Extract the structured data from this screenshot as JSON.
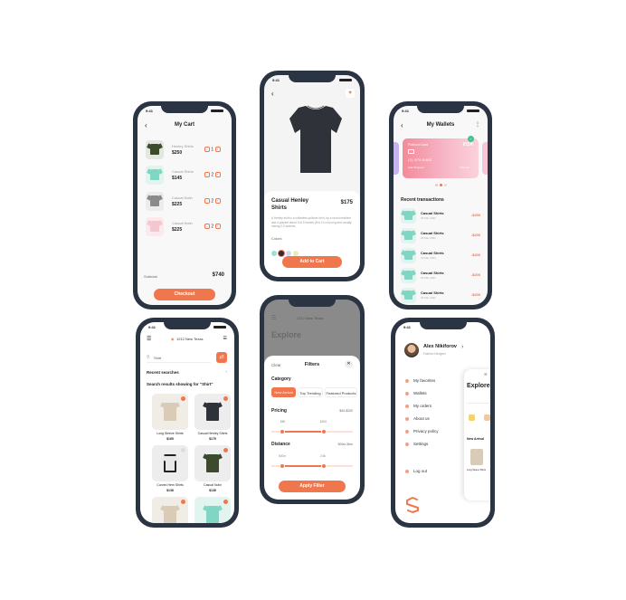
{
  "cart": {
    "time": "9:41",
    "title": "My Cart",
    "items": [
      {
        "name": "Henley Shirts",
        "price": "$250",
        "qty": "1",
        "color": "#3c4a2e"
      },
      {
        "name": "Casual Shirts",
        "price": "$145",
        "qty": "2",
        "color": "#7fd6c2"
      },
      {
        "name": "Casual Nolin",
        "price": "$225",
        "qty": "2",
        "color": "#8a8a8a"
      },
      {
        "name": "Casual Nolin",
        "price": "$225",
        "qty": "2",
        "color": "#f4c7d0"
      }
    ],
    "subtotal_label": "Subtotal",
    "subtotal_value": "$740",
    "checkout": "Checkout"
  },
  "product": {
    "time": "9:41",
    "name_line1": "Casual Henley",
    "name_line2": "Shirts",
    "price": "$175",
    "description": "A Henley shirt is a collarless pullover shirt, by a round neckline and a placket about 3 to 5 inches (8 to 13 cm) long and usually having 2-5 buttons.",
    "colors_label": "Colors",
    "colors": [
      "#9be0d0",
      "#2b2b3a",
      "#cfd8f0",
      "#f3e6b8"
    ],
    "add_to_cart": "Add to Cart"
  },
  "wallet": {
    "time": "9:41",
    "title": "My Wallets",
    "card_label": "Platinum Card",
    "card_brand": "VISA",
    "card_number": "(2) 579 8483",
    "card_holder": "Isak Simpson",
    "card_extra": "Thomas",
    "section": "Recent transactions",
    "transactions": [
      {
        "name": "Casual Shirts",
        "date": "23 Mar 2021",
        "amount": "-$250"
      },
      {
        "name": "Casual Shirts",
        "date": "23 Mar 2021",
        "amount": "-$200"
      },
      {
        "name": "Casual Shirts",
        "date": "23 Mar 2021",
        "amount": "-$200"
      },
      {
        "name": "Casual Shirts",
        "date": "23 Mar 2021",
        "amount": "-$200"
      },
      {
        "name": "Casual Shirts",
        "date": "23 Mar 2021",
        "amount": "-$200"
      }
    ]
  },
  "search": {
    "time": "9:41",
    "location": "1212 New Texas",
    "query": "Shirt",
    "recent": "Recent searches",
    "results_title": "Search results showing for \"Shirt\"",
    "results": [
      {
        "name": "Long Sleeve Shirts",
        "price": "$165"
      },
      {
        "name": "Casual Henley Shirts",
        "price": "$175"
      },
      {
        "name": "Curved Hem Shirts",
        "price": "$138"
      },
      {
        "name": "Casual Nolin",
        "price": "$138"
      }
    ]
  },
  "filters": {
    "background_title": "Explore",
    "background_location": "1212 New Texas",
    "clear": "Clear",
    "title": "Filters",
    "category": "Category",
    "chips": [
      "New Arrival",
      "Top Trending",
      "Featured Products"
    ],
    "pricing": "Pricing",
    "pricing_range": "$40-$200",
    "price_min": "$80",
    "price_max": "$200",
    "distance": "Distance",
    "distance_range": "500m-5km",
    "distance_min": "500m",
    "distance_max": "2.5k",
    "apply": "Apply Filter"
  },
  "menu": {
    "time": "9:41",
    "user_name": "Alex Nikiforov",
    "user_role": "Fashion Designer",
    "items": [
      "My favorites",
      "Wallets",
      "My orders",
      "About us",
      "Privacy policy",
      "Settings"
    ],
    "logout": "Log out",
    "peek_title": "Explore",
    "peek_section": "New Arrival",
    "peek_product": "Long Sleeve Shirts"
  }
}
